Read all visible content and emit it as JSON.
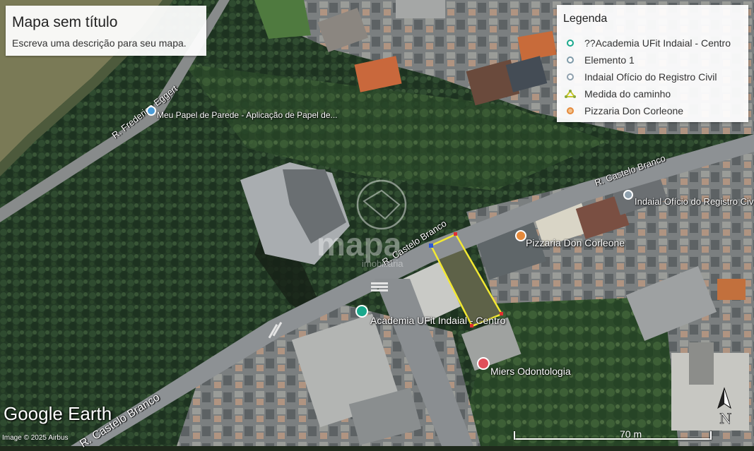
{
  "map": {
    "title": "Mapa sem título",
    "description": "Escreva uma descrição para seu mapa."
  },
  "legend": {
    "heading": "Legenda",
    "items": [
      {
        "label": "??Academia UFit Indaial - Centro",
        "color": "#1aa88c",
        "icon": "green-pin-icon"
      },
      {
        "label": "Elemento 1",
        "color": "#7f9aa8",
        "icon": "gray-pin-icon"
      },
      {
        "label": "Indaial Ofício do Registro Civil",
        "color": "#8fa0ad",
        "icon": "gray-pin-icon"
      },
      {
        "label": "Medida do caminho",
        "color": "#c9c92a",
        "icon": "path-measure-icon"
      },
      {
        "label": "Pizzaria Don Corleone",
        "color": "#e58a3c",
        "icon": "orange-pin-icon"
      }
    ]
  },
  "places": {
    "papel": "Meu Papel de Parede - Aplicação de Papel de...",
    "registro": "Indaial Ofício do Registro Civ",
    "pizzaria": "Pizzaria Don Corleone",
    "academia": "Academia UFit Indaial - Centro",
    "miers": "Miers Odontologia"
  },
  "roads": {
    "frederico": "R. Frederico Eggert",
    "castelo_1": "R. Castelo Branco",
    "castelo_2": "R. Castelo Branco",
    "castelo_3": "R. Castelo Branco"
  },
  "watermark": {
    "brand": "mapa",
    "sub": "imobiliária"
  },
  "branding": {
    "logo": "Google Earth",
    "copyright": "Image © 2025 Airbus",
    "north": "N"
  },
  "scale": {
    "label": "70 m"
  },
  "colors": {
    "forest": "#27402a",
    "river": "#7c7a55",
    "road": "#8b8f92",
    "path": "#f2e832",
    "path_node": "#e03030"
  }
}
